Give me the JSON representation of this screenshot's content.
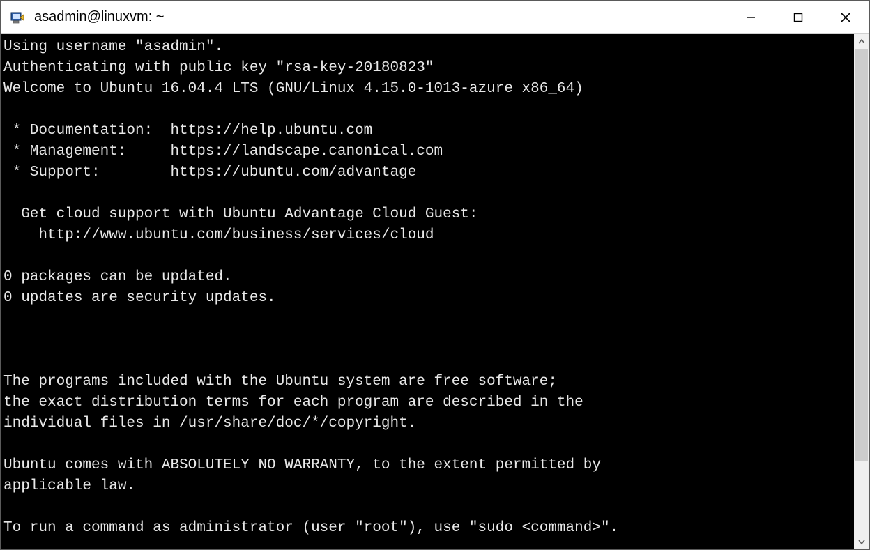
{
  "window": {
    "title": "asadmin@linuxvm: ~"
  },
  "terminal": {
    "lines": [
      "Using username \"asadmin\".",
      "Authenticating with public key \"rsa-key-20180823\"",
      "Welcome to Ubuntu 16.04.4 LTS (GNU/Linux 4.15.0-1013-azure x86_64)",
      "",
      " * Documentation:  https://help.ubuntu.com",
      " * Management:     https://landscape.canonical.com",
      " * Support:        https://ubuntu.com/advantage",
      "",
      "  Get cloud support with Ubuntu Advantage Cloud Guest:",
      "    http://www.ubuntu.com/business/services/cloud",
      "",
      "0 packages can be updated.",
      "0 updates are security updates.",
      "",
      "",
      "",
      "The programs included with the Ubuntu system are free software;",
      "the exact distribution terms for each program are described in the",
      "individual files in /usr/share/doc/*/copyright.",
      "",
      "Ubuntu comes with ABSOLUTELY NO WARRANTY, to the extent permitted by",
      "applicable law.",
      "",
      "To run a command as administrator (user \"root\"), use \"sudo <command>\"."
    ]
  }
}
